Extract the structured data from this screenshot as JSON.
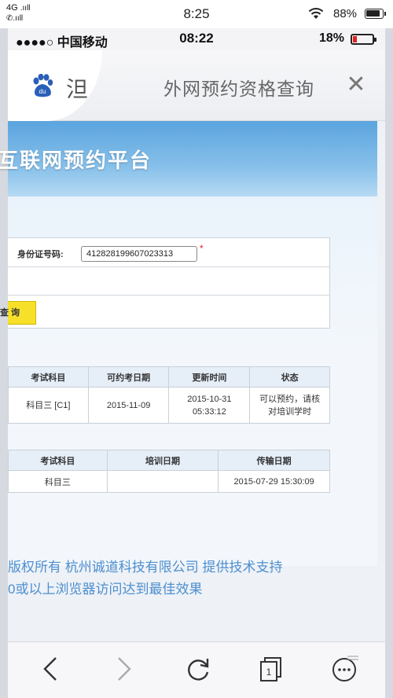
{
  "outer_status": {
    "network": "4G",
    "time": "8:25",
    "battery_pct": "88%"
  },
  "inner_status": {
    "carrier": "●●●●○ 中国移动",
    "time": "08:22",
    "battery_pct": "18%"
  },
  "titlebar": {
    "partial_tab_char": "泹",
    "title": "外网预约资格查询",
    "close": "✕"
  },
  "banner": {
    "text": "互联网预约平台"
  },
  "form": {
    "id_label": "身份证号码:",
    "id_value": "412828199607023313",
    "required_mark": "*",
    "query_button": "查 询"
  },
  "table1": {
    "headers": [
      "考试科目",
      "可约考日期",
      "更新时间",
      "状态"
    ],
    "row": {
      "subject": "科目三 [C1]",
      "date": "2015-11-09",
      "update_date": "2015-10-31",
      "update_time": "05:33:12",
      "status_line1": "可以预约，请核",
      "status_line2": "对培训学时"
    }
  },
  "table2": {
    "headers": [
      "考试科目",
      "培训日期",
      "传输日期"
    ],
    "row": {
      "subject": "科目三",
      "train_date": "",
      "transfer_date": "2015-07-29 15:30:09"
    }
  },
  "footer": {
    "line1": "版权所有 杭州诚道科技有限公司 提供技术支持",
    "line2": "0或以上浏览器访问达到最佳效果"
  },
  "bottom_nav": {
    "tab_count": "1"
  },
  "colors": {
    "banner": "#5ba4de",
    "button": "#f6e02a",
    "footer_text": "#4d8fd0",
    "required": "#e02020"
  }
}
